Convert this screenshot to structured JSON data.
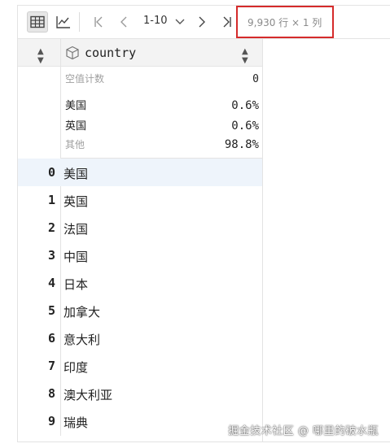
{
  "toolbar": {
    "table_view_icon": "table-icon",
    "chart_view_icon": "line-chart-icon",
    "first_page_icon": "first-page-icon",
    "prev_page_icon": "chevron-left-icon",
    "page_range": "1-10",
    "page_dropdown_icon": "chevron-down-icon",
    "next_page_icon": "chevron-right-icon",
    "last_page_icon": "last-page-icon",
    "shape_label": "9,930 行 × 1 列"
  },
  "header": {
    "column_name": "country",
    "column_type_icon": "cube-icon",
    "sort_icon": "sort-arrows-icon"
  },
  "summary": {
    "rows": [
      {
        "label": "空值计数",
        "value": "0"
      },
      {
        "label": "美国",
        "value": "0.6%"
      },
      {
        "label": "英国",
        "value": "0.6%"
      },
      {
        "label": "其他",
        "value": "98.8%"
      }
    ]
  },
  "rows": [
    {
      "index": "0",
      "value": "美国"
    },
    {
      "index": "1",
      "value": "英国"
    },
    {
      "index": "2",
      "value": "法国"
    },
    {
      "index": "3",
      "value": "中国"
    },
    {
      "index": "4",
      "value": "日本"
    },
    {
      "index": "5",
      "value": "加拿大"
    },
    {
      "index": "6",
      "value": "意大利"
    },
    {
      "index": "7",
      "value": "印度"
    },
    {
      "index": "8",
      "value": "澳大利亚"
    },
    {
      "index": "9",
      "value": "瑞典"
    }
  ],
  "watermark": "掘金技术社区 @ 哪里的破水瓶",
  "colors": {
    "highlight_border": "#d52b2b",
    "selected_row": "#eef4fb",
    "header_bg": "#f3f3f3"
  }
}
